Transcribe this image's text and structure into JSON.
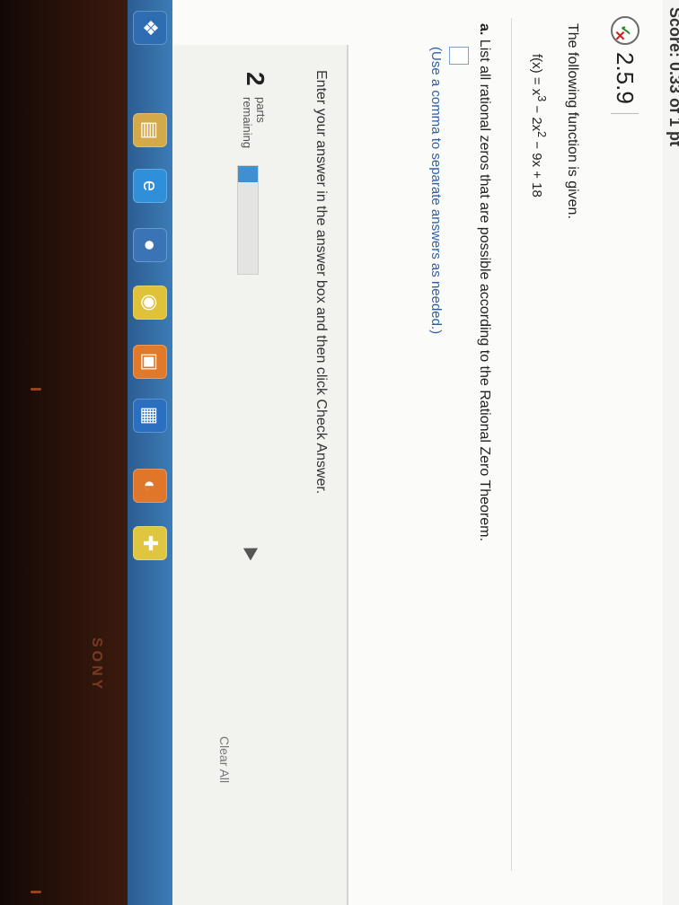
{
  "header": {
    "score_text": "Score: 0.33 of 1 pt"
  },
  "question": {
    "number": "2.5.9",
    "prompt": "The following function is given.",
    "formula_html": "f(x) = x<sup>3</sup> − 2x<sup>2</sup> − 9x + 18",
    "part_label": "a.",
    "part_text": "List all rational zeros that are possible according to the Rational Zero Theorem.",
    "hint": "(Use a comma to separate answers as needed.)"
  },
  "footer": {
    "instructions": "Enter your answer in the answer box and then click Check Answer.",
    "parts_count": "2",
    "parts_line1": "parts",
    "parts_line2": "remaining",
    "progress_fraction": 0.15,
    "clear_all": "Clear All"
  },
  "bezel": {
    "brand": "SONY"
  },
  "taskbar": {
    "icons": [
      {
        "name": "windows-start-icon",
        "glyph": "❖",
        "color": "#2f6db3"
      },
      {
        "name": "file-explorer-icon",
        "glyph": "▤",
        "color": "#d4a94a"
      },
      {
        "name": "internet-explorer-icon",
        "glyph": "e",
        "color": "#2f8fd8"
      },
      {
        "name": "media-player-icon",
        "glyph": "●",
        "color": "#3a73b6"
      },
      {
        "name": "chrome-icon",
        "glyph": "◉",
        "color": "#e0c23a"
      },
      {
        "name": "app-orange-icon",
        "glyph": "▣",
        "color": "#e07a2a"
      },
      {
        "name": "app-blue-icon",
        "glyph": "▦",
        "color": "#2a6fc0"
      },
      {
        "name": "firefox-icon",
        "glyph": "◐",
        "color": "#e0762a"
      },
      {
        "name": "app-yellow-icon",
        "glyph": "✚",
        "color": "#e0c640"
      }
    ]
  }
}
